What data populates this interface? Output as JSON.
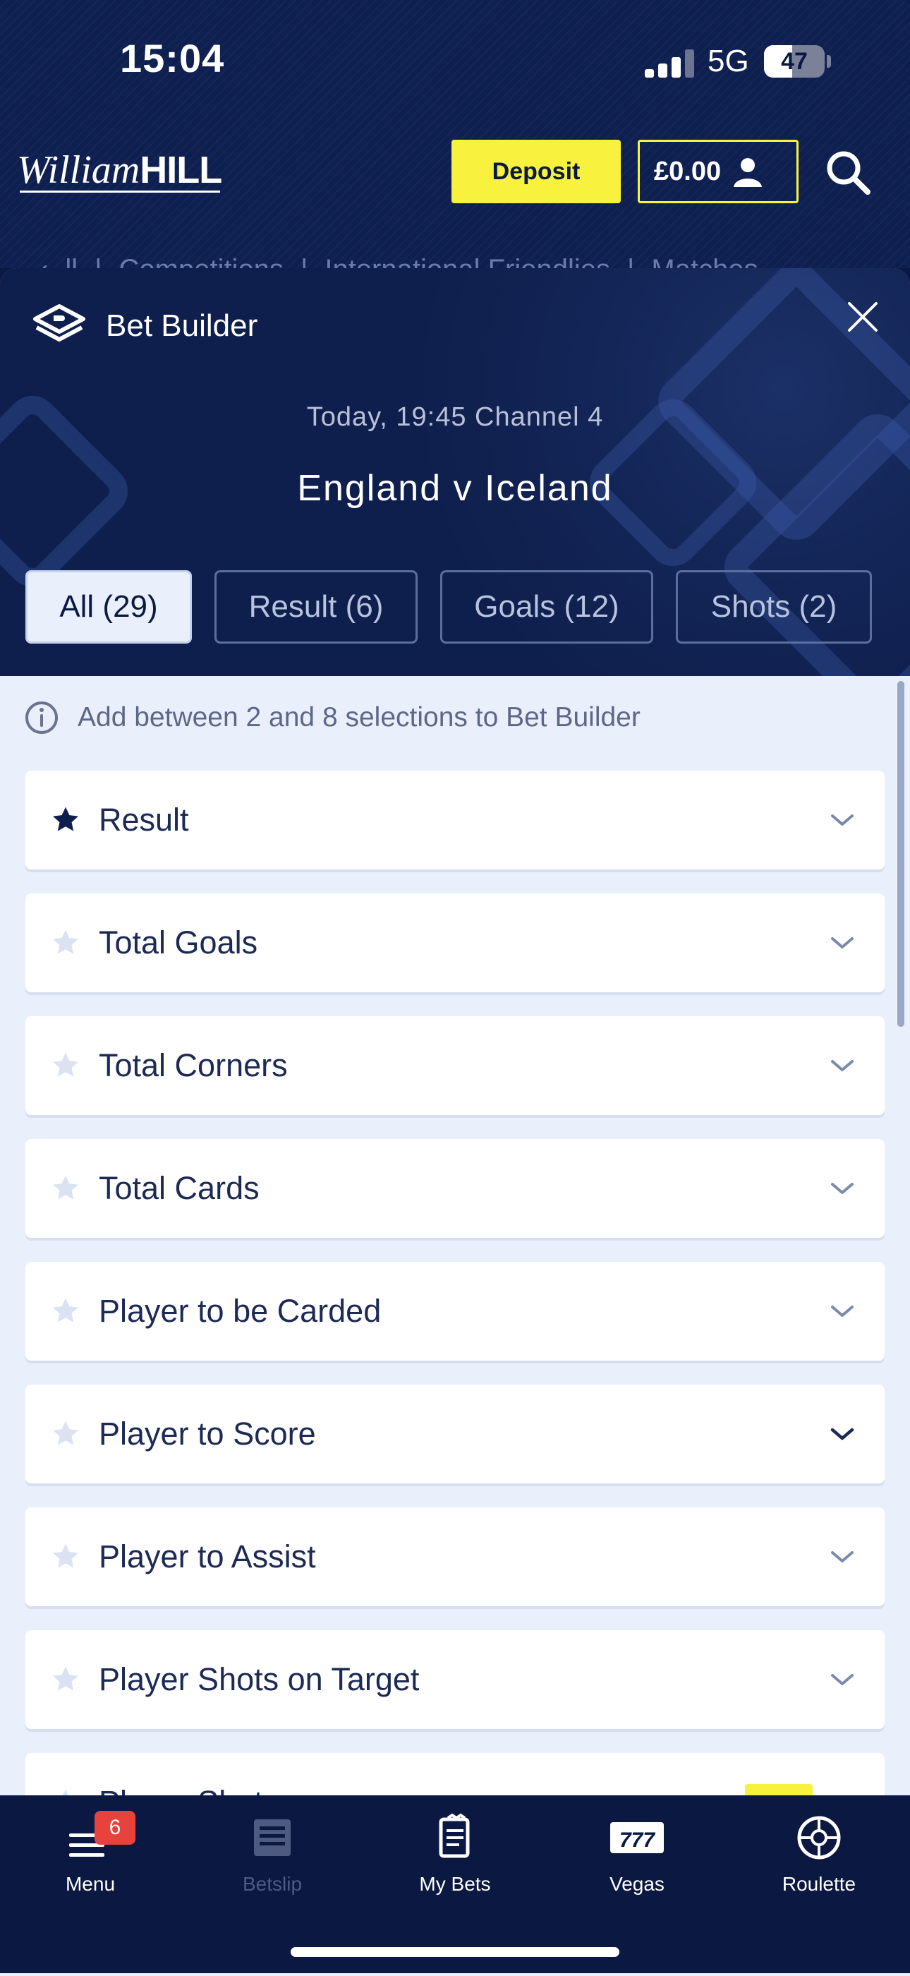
{
  "status_bar": {
    "time": "15:04",
    "network": "5G",
    "battery": "47",
    "battery_level": 0.47
  },
  "header": {
    "brand_script": "William",
    "brand_bold": "HILL",
    "deposit_label": "Deposit",
    "balance": "£0.00"
  },
  "breadcrumb": [
    "ll",
    "Competitions",
    "International Friendlies",
    "Matches"
  ],
  "bet_builder": {
    "title": "Bet Builder",
    "match_time": "Today, 19:45 Channel 4",
    "match_title": "England v Iceland",
    "tabs": [
      {
        "label": "All (29)",
        "active": true
      },
      {
        "label": "Result (6)",
        "active": false
      },
      {
        "label": "Goals (12)",
        "active": false
      },
      {
        "label": "Shots (2)",
        "active": false
      }
    ],
    "info_text": "Add between 2 and 8 selections to Bet Builder",
    "markets": [
      {
        "label": "Result",
        "favourite": true
      },
      {
        "label": "Total Goals",
        "favourite": false
      },
      {
        "label": "Total Corners",
        "favourite": false
      },
      {
        "label": "Total Cards",
        "favourite": false
      },
      {
        "label": "Player to be Carded",
        "favourite": false
      },
      {
        "label": "Player to Score",
        "favourite": false
      },
      {
        "label": "Player to Assist",
        "favourite": false
      },
      {
        "label": "Player Shots on Target",
        "favourite": false
      },
      {
        "label": "Player Shots",
        "favourite": false
      }
    ]
  },
  "bottom_nav": [
    {
      "label": "Menu",
      "icon": "menu-icon",
      "badge": "6"
    },
    {
      "label": "Betslip",
      "icon": "betslip-icon",
      "disabled": true
    },
    {
      "label": "My Bets",
      "icon": "my-bets-icon"
    },
    {
      "label": "Vegas",
      "icon": "vegas-777-icon"
    },
    {
      "label": "Roulette",
      "icon": "roulette-icon"
    }
  ],
  "colors": {
    "navy": "#0b1942",
    "accent_yellow": "#f8f23e",
    "panel_bg": "#e9f0fb",
    "badge_red": "#e8423d"
  }
}
